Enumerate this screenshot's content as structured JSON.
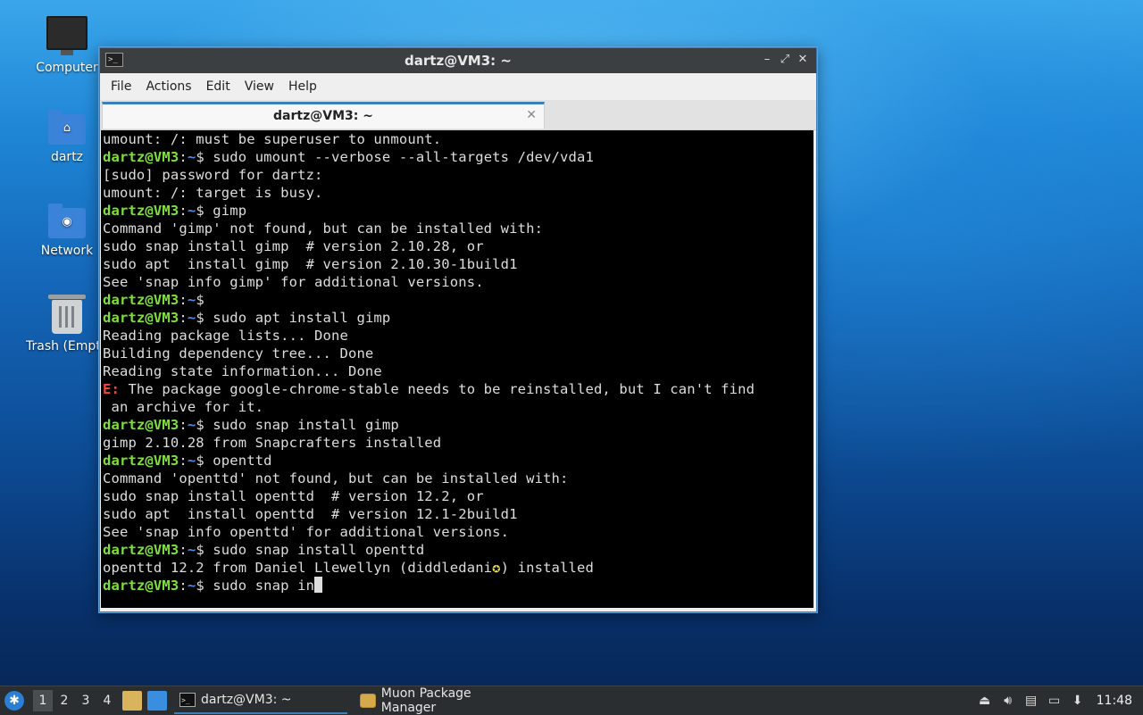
{
  "desktop": {
    "icons": [
      {
        "label": "Computer",
        "icon": "monitor-icon"
      },
      {
        "label": "dartz",
        "icon": "home-folder-icon"
      },
      {
        "label": "Network",
        "icon": "network-folder-icon"
      },
      {
        "label": "Trash (Empt",
        "icon": "trash-icon"
      }
    ]
  },
  "window": {
    "title": "dartz@VM3: ~",
    "controls": {
      "minimize": "–",
      "maximize": "⤢",
      "close": "✕"
    },
    "menu": [
      "File",
      "Actions",
      "Edit",
      "View",
      "Help"
    ],
    "tab": {
      "label": "dartz@VM3: ~",
      "close": "✕"
    }
  },
  "terminal": {
    "prompt_user": "dartz@VM3",
    "prompt_sep": ":",
    "prompt_path": "~",
    "prompt_symbol": "$ ",
    "lines": [
      {
        "type": "out",
        "text": "umount: /: must be superuser to unmount."
      },
      {
        "type": "cmd",
        "text": "sudo umount --verbose --all-targets /dev/vda1"
      },
      {
        "type": "out",
        "text": "[sudo] password for dartz:"
      },
      {
        "type": "out",
        "text": "umount: /: target is busy."
      },
      {
        "type": "cmd",
        "text": "gimp"
      },
      {
        "type": "out",
        "text": "Command 'gimp' not found, but can be installed with:"
      },
      {
        "type": "out",
        "text": "sudo snap install gimp  # version 2.10.28, or"
      },
      {
        "type": "out",
        "text": "sudo apt  install gimp  # version 2.10.30-1build1"
      },
      {
        "type": "out",
        "text": "See 'snap info gimp' for additional versions."
      },
      {
        "type": "cmd",
        "text": ""
      },
      {
        "type": "cmd",
        "text": "sudo apt install gimp"
      },
      {
        "type": "out",
        "text": "Reading package lists... Done"
      },
      {
        "type": "out",
        "text": "Building dependency tree... Done"
      },
      {
        "type": "out",
        "text": "Reading state information... Done"
      },
      {
        "type": "err",
        "prefix": "E:",
        "text": " The package google-chrome-stable needs to be reinstalled, but I can't find"
      },
      {
        "type": "out",
        "text": " an archive for it."
      },
      {
        "type": "cmd",
        "text": "sudo snap install gimp"
      },
      {
        "type": "out",
        "text": "gimp 2.10.28 from Snapcrafters installed"
      },
      {
        "type": "cmd",
        "text": "openttd"
      },
      {
        "type": "out",
        "text": "Command 'openttd' not found, but can be installed with:"
      },
      {
        "type": "out",
        "text": "sudo snap install openttd  # version 12.2, or"
      },
      {
        "type": "out",
        "text": "sudo apt  install openttd  # version 12.1-2build1"
      },
      {
        "type": "out",
        "text": "See 'snap info openttd' for additional versions."
      },
      {
        "type": "cmd",
        "text": "sudo snap install openttd"
      },
      {
        "type": "pub",
        "text": "openttd 12.2 from Daniel Llewellyn (diddledani",
        "mark": "✪",
        "tail": ") installed"
      },
      {
        "type": "cmd",
        "text": "sudo snap in",
        "cursor": true
      }
    ]
  },
  "taskbar": {
    "workspaces": [
      "1",
      "2",
      "3",
      "4"
    ],
    "active_workspace": "1",
    "tasks": [
      {
        "label": "dartz@VM3: ~",
        "active": true,
        "icon": "terminal-icon"
      },
      {
        "label": "Muon Package Manager",
        "active": false,
        "icon": "muon-icon"
      }
    ],
    "clock": "11:48"
  },
  "colors": {
    "prompt_user": "#7ee03a",
    "prompt_path": "#4e8fe0",
    "error": "#f04a3f",
    "accent": "#3c7fb9"
  }
}
